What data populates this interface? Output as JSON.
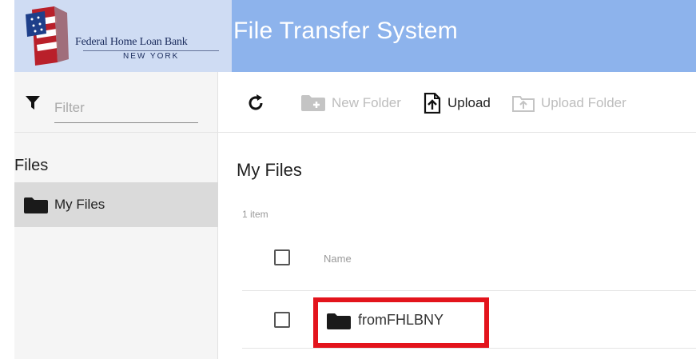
{
  "header": {
    "bank_name": "Federal Home Loan Bank",
    "bank_city": "NEW YORK",
    "app_title": "File Transfer System",
    "colors": {
      "bar": "#8db3ec",
      "logo_panel": "#cfdcf3"
    }
  },
  "sidebar": {
    "filter": {
      "icon": "funnel-icon",
      "placeholder": "Filter",
      "value": ""
    },
    "heading": "Files",
    "items": [
      {
        "label": "My Files",
        "icon": "folder-icon",
        "selected": true
      }
    ]
  },
  "toolbar": {
    "refresh": {
      "icon": "refresh-icon",
      "label": ""
    },
    "new_folder": {
      "icon": "new-folder-icon",
      "label": "New Folder",
      "disabled": true
    },
    "upload": {
      "icon": "upload-icon",
      "label": "Upload",
      "disabled": false
    },
    "upload_folder": {
      "icon": "upload-folder-icon",
      "label": "Upload Folder",
      "disabled": true
    }
  },
  "main": {
    "title": "My Files",
    "item_count": "1 item",
    "columns": [
      "Name"
    ],
    "rows": [
      {
        "name": "fromFHLBNY",
        "type": "folder",
        "icon": "folder-icon",
        "checked": false,
        "highlighted": true
      }
    ],
    "highlight_color": "#e3141c"
  }
}
